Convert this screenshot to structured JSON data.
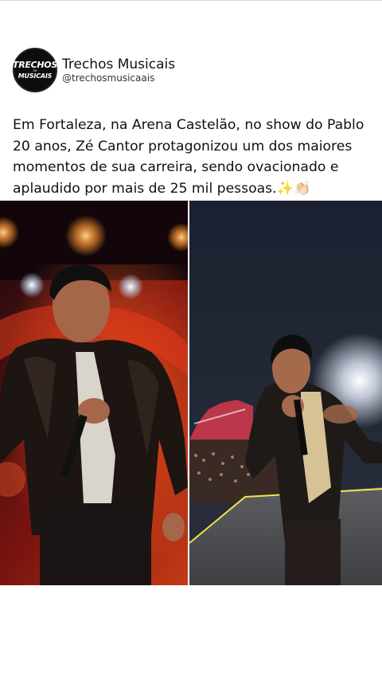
{
  "profile": {
    "avatar_logo_line1": "TRECHOS",
    "avatar_logo_line2": "da",
    "avatar_logo_line3": "MUSICAIS",
    "display_name": "Trechos Musicais",
    "handle": "@trechosmusicaais"
  },
  "post": {
    "text": "Em Fortaleza, na Arena Castelão, no show do Pablo\n20 anos, Zé Cantor protagonizou um dos maiores\nmomentos de sua carreira, sendo ovacionado e\naplaudido por mais de 25 mil pessoas.✨👏🏻"
  },
  "photos": [
    {
      "subject": "singer-on-stage-close-up"
    },
    {
      "subject": "singer-on-stage-with-crowd"
    }
  ],
  "colors": {
    "background": "#ffffff",
    "text": "#111111",
    "handle": "#333333"
  }
}
